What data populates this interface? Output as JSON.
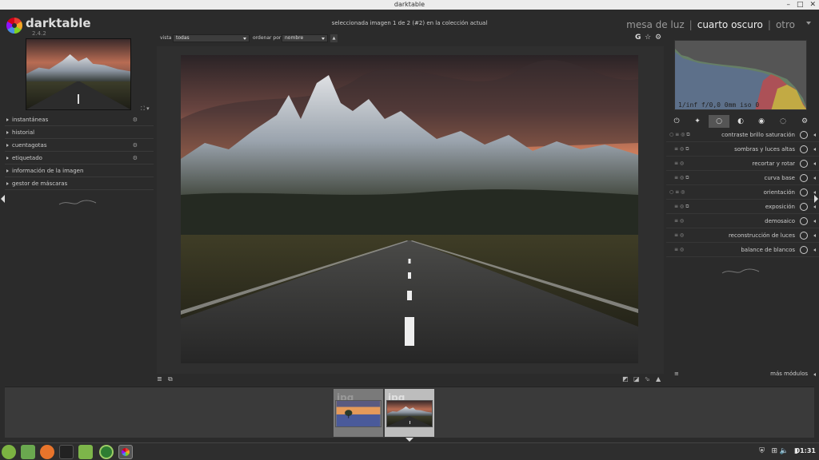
{
  "window": {
    "title": "darktable",
    "controls": [
      "–",
      "□",
      "✕"
    ]
  },
  "app": {
    "name": "darktable",
    "version": "2.4.2"
  },
  "status": "seleccionada imagen 1 de 2 (#2) en la colección actual",
  "views": {
    "mesa": "mesa de luz",
    "sep": "|",
    "cuarto": "cuarto oscuro",
    "otro": "otro"
  },
  "left_panel": {
    "thumb_ctrl": "⛶ ▾",
    "modules": [
      {
        "label": "instantáneas",
        "gear": true
      },
      {
        "label": "historial",
        "gear": false
      },
      {
        "label": "cuentagotas",
        "gear": true
      },
      {
        "label": "etiquetado",
        "gear": true
      },
      {
        "label": "información de la imagen",
        "gear": false
      },
      {
        "label": "gestor de máscaras",
        "gear": false
      }
    ]
  },
  "top_controls": {
    "vista_label": "vista",
    "vista_value": "todas",
    "ordenar_label": "ordenar por",
    "ordenar_value": "nombre",
    "sort_dir": "▲",
    "icons": [
      "G",
      "☆",
      "⚙"
    ]
  },
  "bottom_controls": {
    "left_icons": [
      "≣",
      "⧉"
    ],
    "right_icons": [
      "◩",
      "◪",
      "⬂",
      "▲"
    ]
  },
  "histogram": {
    "info": "1/inf f/0,0 0mm iso 0"
  },
  "module_groups": [
    "⏻",
    "✦",
    "○",
    "◐",
    "◉",
    "◌",
    "⚙"
  ],
  "right_modules": [
    {
      "label": "contraste brillo saturación"
    },
    {
      "label": "sombras y luces altas"
    },
    {
      "label": "recortar y rotar"
    },
    {
      "label": "curva base"
    },
    {
      "label": "orientación"
    },
    {
      "label": "exposición"
    },
    {
      "label": "demosaico"
    },
    {
      "label": "reconstrucción de luces"
    },
    {
      "label": "balance de blancos"
    }
  ],
  "more_modules": "más módulos",
  "more_modules_icon": "≡",
  "filmstrip": [
    {
      "label": "jpg",
      "selected": false,
      "scene": "sunset-tree"
    },
    {
      "label": "jpg",
      "selected": true,
      "scene": "mountain-road"
    }
  ],
  "taskbar": {
    "clock": "01:31"
  },
  "colors": {
    "accent": "#4a4a4a",
    "panel": "#2b2b2b",
    "background": "#202020"
  }
}
